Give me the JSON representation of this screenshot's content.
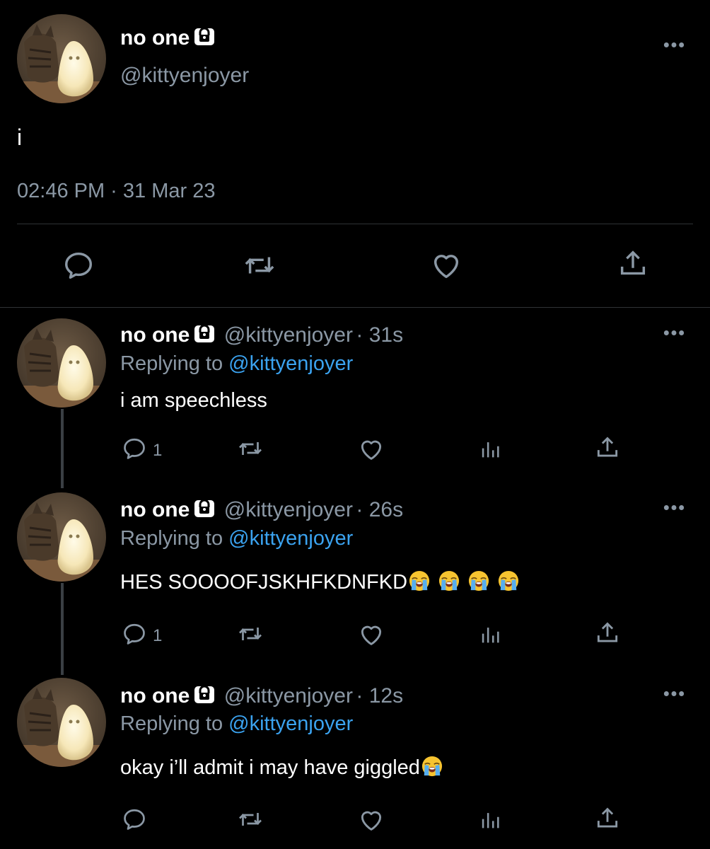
{
  "colors": {
    "background": "#000000",
    "text": "#ffffff",
    "muted": "#8b98a5",
    "link": "#3ba3f0",
    "divider": "#2f3336"
  },
  "main_tweet": {
    "display_name": "no one",
    "handle": "@kittyenjoyer",
    "text": "i",
    "timestamp": "02:46 PM · 31 Mar 23",
    "icons": [
      "reply-icon",
      "retweet-icon",
      "like-icon",
      "share-icon"
    ]
  },
  "replies": [
    {
      "display_name": "no one",
      "handle": "@kittyenjoyer",
      "time": "· 31s",
      "replying_prefix": "Replying to",
      "replying_to": "@kittyenjoyer",
      "text": "i am speechless",
      "reply_count": "1"
    },
    {
      "display_name": "no one",
      "handle": "@kittyenjoyer",
      "time": "· 26s",
      "replying_prefix": "Replying to",
      "replying_to": "@kittyenjoyer",
      "text": "HES SOOOOFJSKHFKDNFKD",
      "emoji": "loudly-crying-face x4",
      "reply_count": "1"
    },
    {
      "display_name": "no one",
      "handle": "@kittyenjoyer",
      "time": "· 12s",
      "replying_prefix": "Replying to",
      "replying_to": "@kittyenjoyer",
      "text": "okay i’ll admit i may have giggled",
      "emoji": "loudly-crying-face x1",
      "reply_count": ""
    }
  ]
}
